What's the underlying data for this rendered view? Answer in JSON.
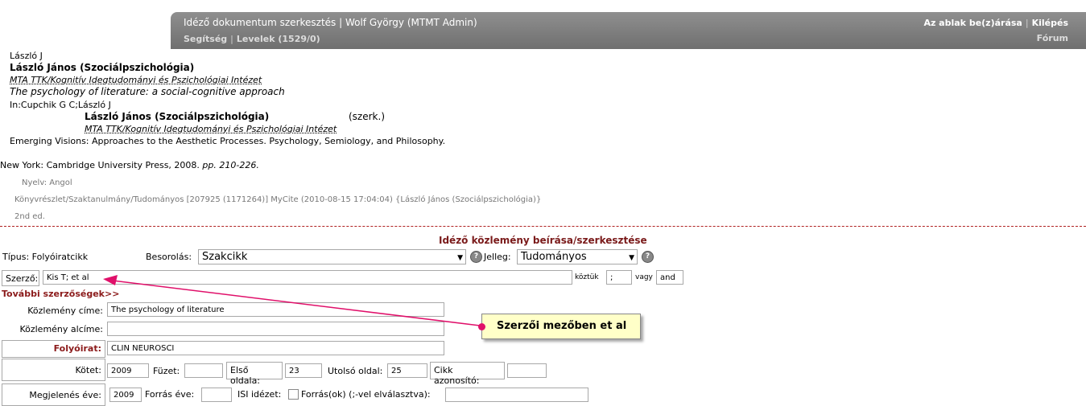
{
  "header": {
    "title": "Idéző dokumentum szerkesztés | Wolf György (MTMT Admin)",
    "help": "Segítség",
    "messages": "Levelek (1529/0)",
    "window_toggle": "Az ablak be(z)árása",
    "logout": "Kilépés",
    "forum": "Fórum"
  },
  "record": {
    "author_short": "László J",
    "author_full": "László János (Szociálpszichológia)",
    "affiliation": "MTA TTK/Kognitív Idegtudományi és Pszichológiai Intézet",
    "title": "The psychology of literature: a social-cognitive approach",
    "in_line": "In:Cupchik G C;László J",
    "editor_full": "László János (Szociálpszichológia)",
    "editor_role": "(szerk.)",
    "editor_affiliation": "MTA TTK/Kognitív Idegtudományi és Pszichológiai Intézet",
    "book_title": "Emerging Visions: Approaches to the Aesthetic Processes. Psychology, Semiology, and Philosophy.",
    "publisher": "New York: Cambridge University Press, 2008.",
    "pages": "pp. 210-226.",
    "language": "Nyelv: Angol",
    "meta": "Könyvrészlet/Szaktanulmány/Tudományos [207925 (1171264)] MyCite (2010-08-15 17:04:04) {László János (Szociálpszichológia)}",
    "edition": "2nd ed."
  },
  "form": {
    "heading": "Idéző közlemény beírása/szerkesztése",
    "type_label": "Típus: Folyóiratcikk",
    "class_label": "Besorolás:",
    "class_value": "Szakcikk",
    "nature_label": "Jelleg:",
    "nature_value": "Tudományos",
    "author_label": "Szerző:",
    "author_value": "Kis T; et al",
    "separator_label": "köztük",
    "separator_value": ";",
    "or_label": "vagy",
    "or_value": "and",
    "more_authors": "További szerzőségek>>",
    "pub_title_label": "Közlemény címe:",
    "pub_title_value": "The psychology of literature",
    "subtitle_label": "Közlemény alcíme:",
    "subtitle_value": "",
    "journal_label": "Folyóirat:",
    "journal_value": "CLIN NEUROSCI",
    "volume_label": "Kötet:",
    "volume_value": "2009",
    "issue_label": "Füzet:",
    "issue_value": "",
    "first_page_label": "Első oldala:",
    "first_page_value": "23",
    "last_page_label": "Utolsó oldal:",
    "last_page_value": "25",
    "article_id_label": "Cikk azonosító:",
    "article_id_value": "",
    "pub_year_label": "Megjelenés éve:",
    "pub_year_value": "2009",
    "source_year_label": "Forrás éve:",
    "source_year_value": "",
    "isi_label": "ISI idézet:",
    "sources_label": "Forrás(ok) (;-vel elválasztva):",
    "sources_value": ""
  },
  "annotation": {
    "text": "Szerzői mezőben et al",
    "color": "#e0106a"
  }
}
